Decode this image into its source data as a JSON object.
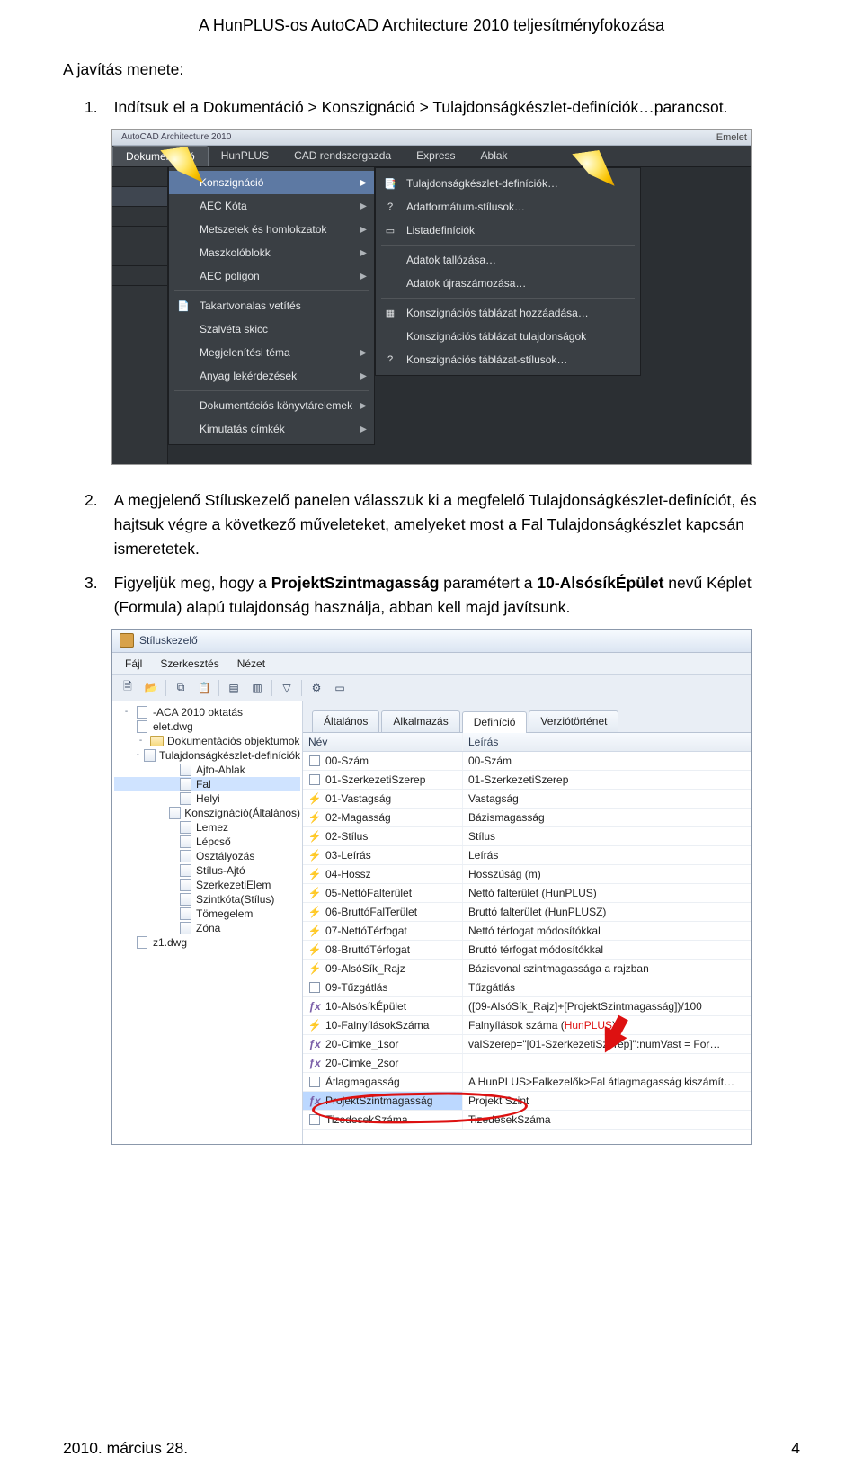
{
  "doc": {
    "title": "A HunPLUS-os AutoCAD Architecture 2010 teljesítményfokozása",
    "section_label": "A javítás menete:",
    "step1_num": "1.",
    "step1_text": "Indítsuk el a Dokumentáció > Konszignáció > Tulajdonságkészlet-definíciók…parancsot.",
    "step2_num": "2.",
    "step2_text": "A megjelenő Stíluskezelő panelen válasszuk ki a megfelelő Tulajdonságkészlet-definíciót, és hajtsuk végre a következő műveleteket, amelyeket most a Fal Tulajdonságkészlet kapcsán ismeretetek.",
    "step3_num": "3.",
    "step3_pre": "Figyeljük meg, hogy a ",
    "step3_b1": "ProjektSzintmagasság",
    "step3_mid": " paramétert a ",
    "step3_b2": "10-AlsósíkÉpület",
    "step3_post": " nevű Képlet (Formula) alapú tulajdonság használja, abban kell majd javítsunk.",
    "footer_left": "2010. március 28.",
    "footer_right": "4"
  },
  "shot1": {
    "titlebar_app": "AutoCAD Architecture 2010",
    "titlebar_edition": "Emelet",
    "menubar": [
      "Dokumentáció",
      "HunPLUS",
      "CAD rendszergazda",
      "Express",
      "Ablak"
    ],
    "dropdown": [
      {
        "label": "Konszignáció",
        "sel": true,
        "arrow": true,
        "icon": ""
      },
      {
        "label": "AEC Kóta",
        "arrow": true,
        "icon": ""
      },
      {
        "label": "Metszetek és homlokzatok",
        "arrow": true,
        "icon": ""
      },
      {
        "label": "Maszkolóblokk",
        "arrow": true,
        "icon": ""
      },
      {
        "label": "AEC poligon",
        "arrow": true,
        "icon": ""
      },
      {
        "sep": true
      },
      {
        "label": "Takartvonalas vetítés",
        "icon": "📄"
      },
      {
        "label": "Szalvéta skicc",
        "icon": ""
      },
      {
        "label": "Megjelenítési téma",
        "arrow": true,
        "icon": ""
      },
      {
        "label": "Anyag lekérdezések",
        "arrow": true,
        "icon": ""
      },
      {
        "sep": true
      },
      {
        "label": "Dokumentációs könyvtárelemek",
        "arrow": true,
        "icon": ""
      },
      {
        "label": "Kimutatás címkék",
        "arrow": true,
        "icon": ""
      }
    ],
    "submenu": [
      {
        "label": "Tulajdonságkészlet-definíciók…",
        "icon": "📑"
      },
      {
        "label": "Adatformátum-stílusok…",
        "icon": "?"
      },
      {
        "label": "Listadefiníciók",
        "icon": "▭"
      },
      {
        "sep": true
      },
      {
        "label": "Adatok tallózása…",
        "icon": ""
      },
      {
        "label": "Adatok újraszámozása…",
        "icon": ""
      },
      {
        "sep": true
      },
      {
        "label": "Konszignációs táblázat hozzáadása…",
        "icon": "▦"
      },
      {
        "label": "Konszignációs táblázat tulajdonságok",
        "icon": ""
      },
      {
        "label": "Konszignációs táblázat-stílusok…",
        "icon": "?"
      }
    ]
  },
  "shot2": {
    "title": "Stíluskezelő",
    "menubar": [
      "Fájl",
      "Szerkesztés",
      "Nézet"
    ],
    "tree": [
      {
        "d": 0,
        "exp": "-",
        "icon": "doc",
        "label": "-ACA 2010 oktatás"
      },
      {
        "d": 0,
        "exp": "",
        "icon": "doc",
        "label": "elet.dwg"
      },
      {
        "d": 1,
        "exp": "-",
        "icon": "fold",
        "label": "Dokumentációs objektumok"
      },
      {
        "d": 2,
        "exp": "-",
        "icon": "page",
        "label": "Tulajdonságkészlet-definíciók"
      },
      {
        "d": 3,
        "icon": "page",
        "label": "Ajto-Ablak"
      },
      {
        "d": 3,
        "icon": "page",
        "label": "Fal",
        "sel": true
      },
      {
        "d": 3,
        "icon": "page",
        "label": "Helyi"
      },
      {
        "d": 3,
        "icon": "page",
        "label": "Konszignáció(Általános)"
      },
      {
        "d": 3,
        "icon": "page",
        "label": "Lemez"
      },
      {
        "d": 3,
        "icon": "page",
        "label": "Lépcső"
      },
      {
        "d": 3,
        "icon": "page",
        "label": "Osztályozás"
      },
      {
        "d": 3,
        "icon": "page",
        "label": "Stílus-Ajtó"
      },
      {
        "d": 3,
        "icon": "page",
        "label": "SzerkezetiElem"
      },
      {
        "d": 3,
        "icon": "page",
        "label": "Szintkóta(Stílus)"
      },
      {
        "d": 3,
        "icon": "page",
        "label": "Tömegelem"
      },
      {
        "d": 3,
        "icon": "page",
        "label": "Zóna"
      },
      {
        "d": 0,
        "exp": "",
        "icon": "doc",
        "label": "z1.dwg"
      }
    ],
    "tabs": [
      "Általános",
      "Alkalmazás",
      "Definíció",
      "Verziótörténet"
    ],
    "grid_head": {
      "name": "Név",
      "desc": "Leírás"
    },
    "grid": [
      {
        "i": "box",
        "name": "00-Szám",
        "desc": "00-Szám"
      },
      {
        "i": "box",
        "name": "01-SzerkezetiSzerep",
        "desc": "01-SzerkezetiSzerep"
      },
      {
        "i": "auto",
        "name": "01-Vastagság",
        "desc": "Vastagság"
      },
      {
        "i": "auto",
        "name": "02-Magasság",
        "desc": "Bázismagasság"
      },
      {
        "i": "auto",
        "name": "02-Stílus",
        "desc": "Stílus"
      },
      {
        "i": "auto",
        "name": "03-Leírás",
        "desc": "Leírás"
      },
      {
        "i": "auto",
        "name": "04-Hossz",
        "desc": "Hosszúság (m)"
      },
      {
        "i": "auto",
        "name": "05-NettóFalterület",
        "desc": "Nettó falterület (HunPLUS)"
      },
      {
        "i": "auto",
        "name": "06-BruttóFalTerület",
        "desc": "Bruttó falterület (HunPLUSZ)"
      },
      {
        "i": "auto",
        "name": "07-NettóTérfogat",
        "desc": "Nettó térfogat módosítókkal"
      },
      {
        "i": "auto",
        "name": "08-BruttóTérfogat",
        "desc": "Bruttó térfogat módosítókkal"
      },
      {
        "i": "auto",
        "name": "09-AlsóSík_Rajz",
        "desc": "Bázisvonal szintmagassága a rajzban"
      },
      {
        "i": "box",
        "name": "09-Tűzgátlás",
        "desc": "Tűzgátlás"
      },
      {
        "i": "fx",
        "name": "10-AlsósíkÉpület",
        "desc": "([09-AlsóSík_Rajz]+[ProjektSzintmagasság])/100"
      },
      {
        "i": "auto",
        "name": "10-FalnyílásokSzáma",
        "desc": "Falnyílások száma (HunPLUS)",
        "hp": true
      },
      {
        "i": "fx",
        "name": "20-Cimke_1sor",
        "desc": "valSzerep=\"[01-SzerkezetiSzerep]\":numVast = For…"
      },
      {
        "i": "fx",
        "name": "20-Cimke_2sor",
        "desc": ""
      },
      {
        "i": "box",
        "name": "Átlagmagasság",
        "desc": "A HunPLUS>Falkezelők>Fal átlagmagasság kiszámít…"
      },
      {
        "i": "fx",
        "name": "ProjektSzintmagasság",
        "desc": "Projekt Szint",
        "sel": true
      },
      {
        "i": "box",
        "name": "TizedesekSzáma",
        "desc": "TizedesekSzáma"
      }
    ]
  }
}
